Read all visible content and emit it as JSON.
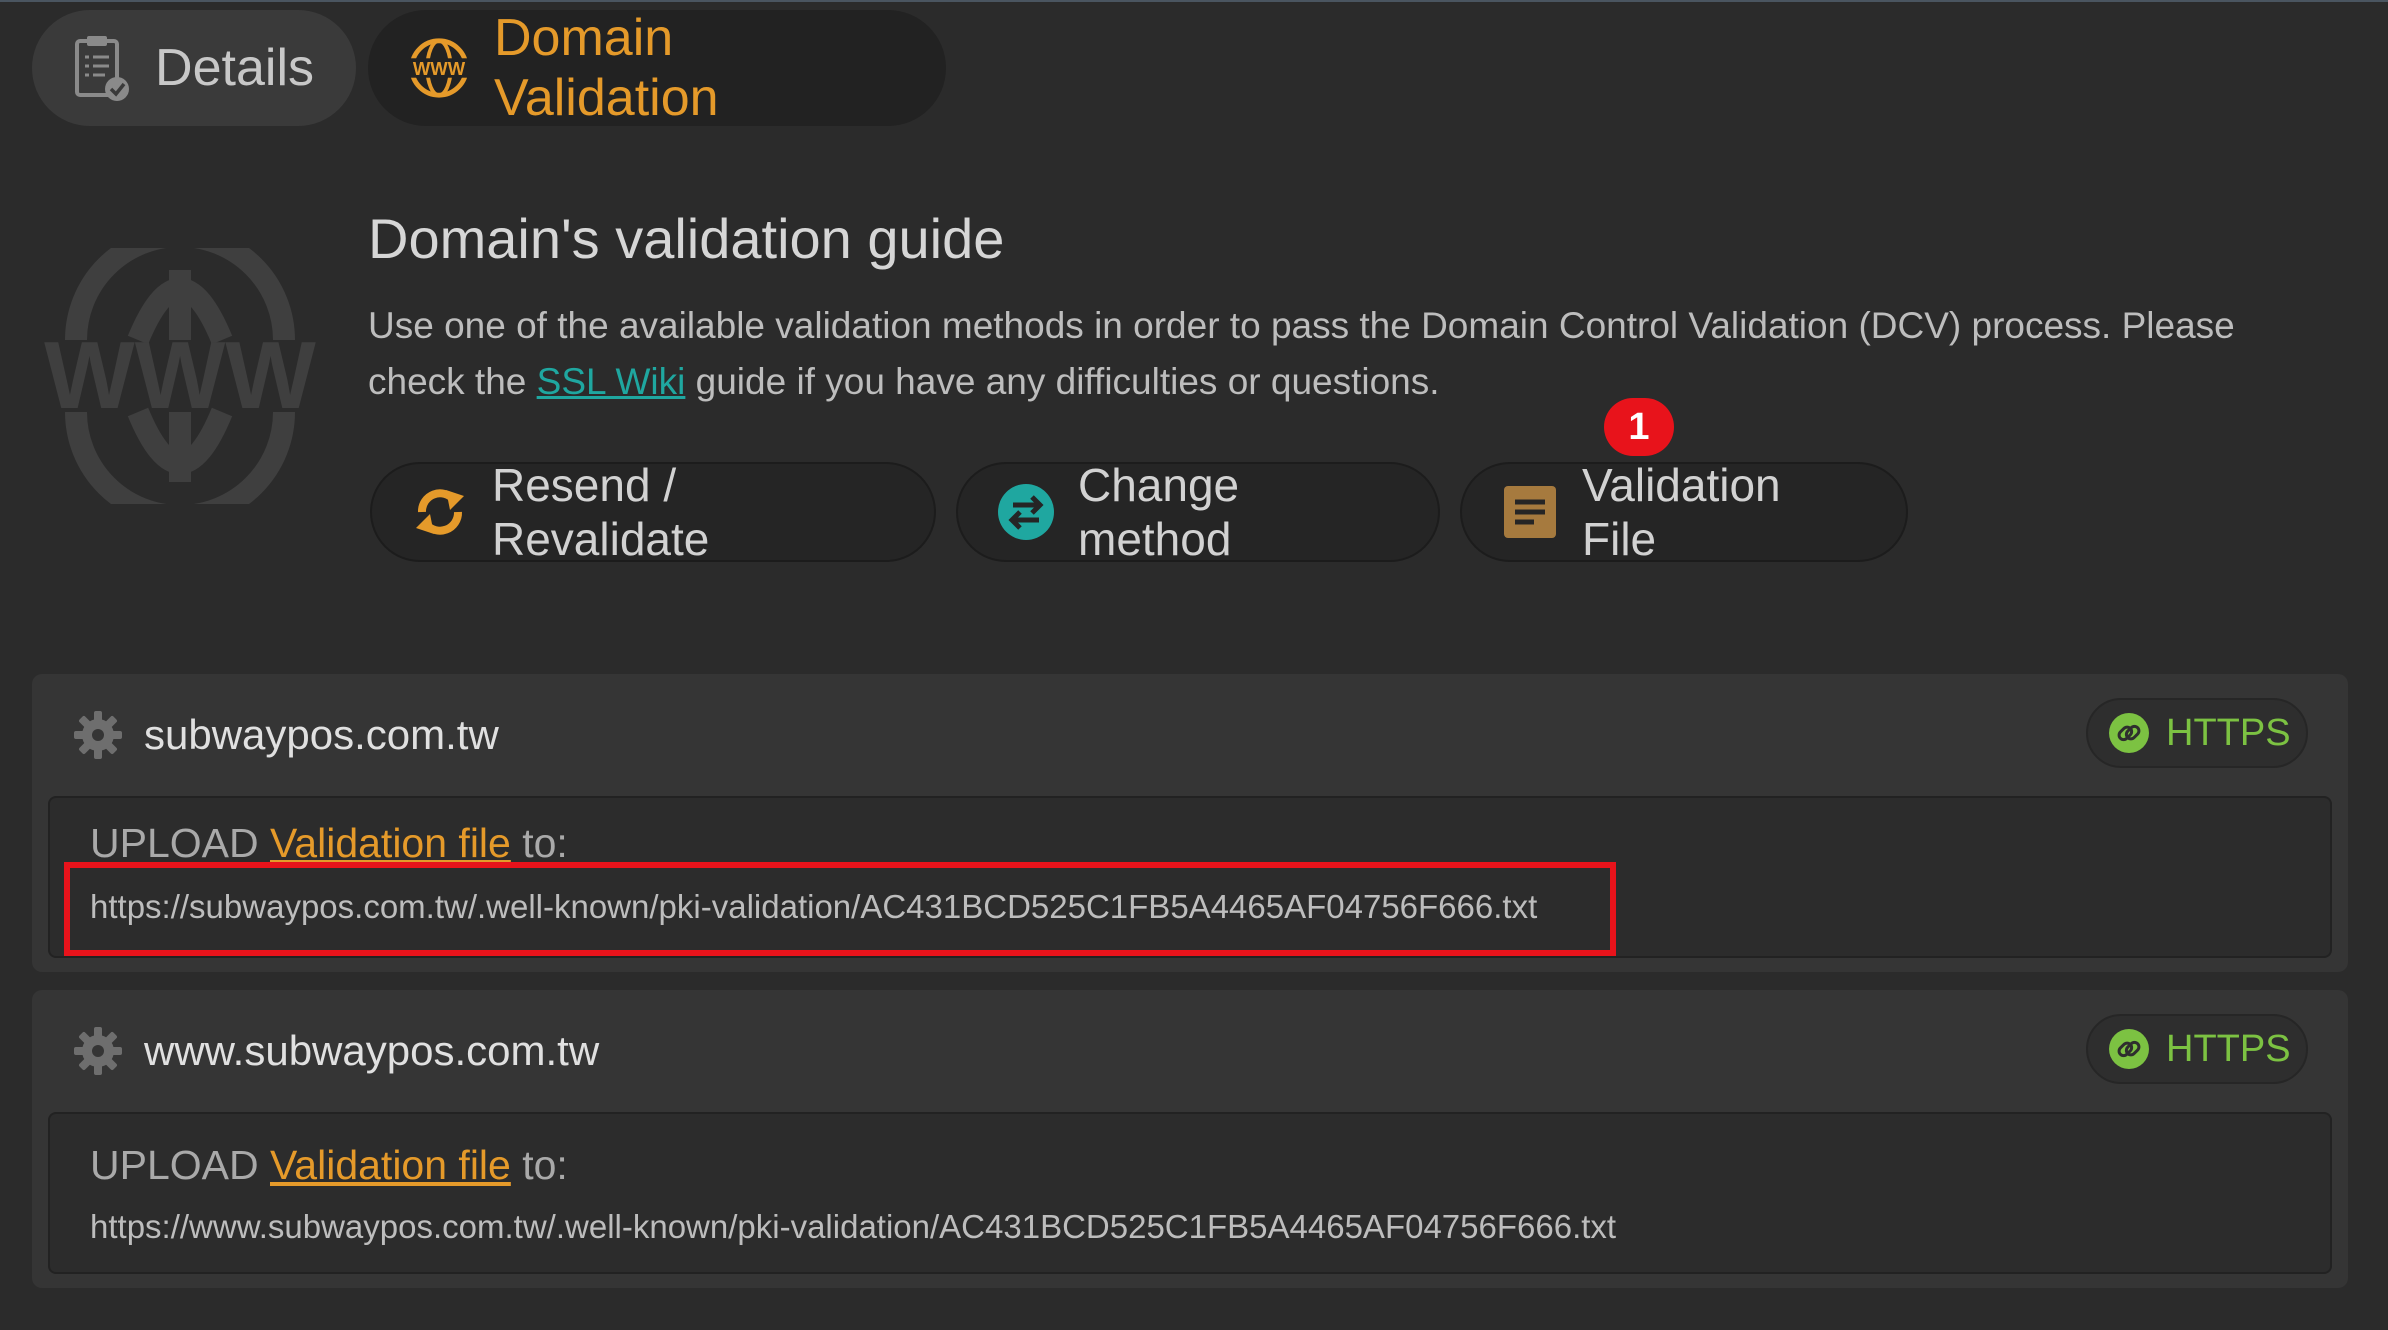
{
  "tabs": [
    {
      "label": "Details",
      "icon": "clipboard-check-icon"
    },
    {
      "label": "Domain Validation",
      "icon": "www-globe-icon",
      "active": true
    }
  ],
  "guide": {
    "title": "Domain's validation guide",
    "desc_before": "Use one of the available validation methods in order to pass the Domain Control Validation (DCV) process. Please check the ",
    "link": "SSL Wiki",
    "desc_after": " guide if you have any difficulties or questions.",
    "logo_text": "WWW"
  },
  "actions": {
    "resend": "Resend / Revalidate",
    "change": "Change method",
    "validation_file": "Validation File"
  },
  "notification_badge": "1",
  "domains": [
    {
      "name": "subwaypos.com.tw",
      "protocol": "HTTPS",
      "upload_prefix": "UPLOAD ",
      "upload_link": "Validation file",
      "upload_suffix": " to:",
      "url": "https://subwaypos.com.tw/.well-known/pki-validation/AC431BCD525C1FB5A4465AF04756F666.txt"
    },
    {
      "name": "www.subwaypos.com.tw",
      "protocol": "HTTPS",
      "upload_prefix": "UPLOAD ",
      "upload_link": "Validation file",
      "upload_suffix": " to:",
      "url": "https://www.subwaypos.com.tw/.well-known/pki-validation/AC431BCD525C1FB5A4465AF04756F666.txt"
    }
  ],
  "colors": {
    "accent_orange": "#e59a2a",
    "link_teal": "#1fa7a0",
    "https_green": "#7cc242",
    "badge_red": "#e8131b"
  }
}
